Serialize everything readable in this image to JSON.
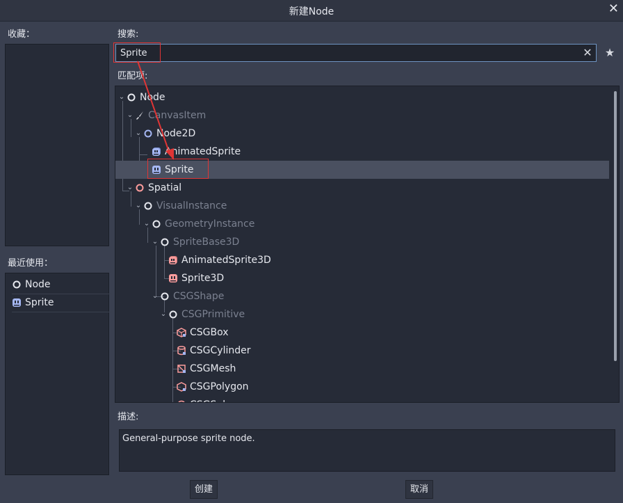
{
  "dialog": {
    "title": "新建Node"
  },
  "favorites": {
    "label": "收藏："
  },
  "recent": {
    "label": "最近使用：",
    "items": [
      {
        "label": "Node",
        "icon": "node-icon"
      },
      {
        "label": "Sprite",
        "icon": "sprite-icon"
      }
    ]
  },
  "search": {
    "label": "搜索:",
    "value": "Sprite"
  },
  "matches": {
    "label": "匹配项:",
    "items": [
      {
        "label": "Node",
        "icon": "node-icon",
        "dim": false
      },
      {
        "label": "CanvasItem",
        "icon": "brush-icon",
        "dim": true
      },
      {
        "label": "Node2D",
        "icon": "node2d-icon",
        "dim": false
      },
      {
        "label": "AnimatedSprite",
        "icon": "animated-sprite-icon",
        "dim": false
      },
      {
        "label": "Sprite",
        "icon": "sprite-icon",
        "dim": false,
        "selected": true
      },
      {
        "label": "Spatial",
        "icon": "spatial-icon",
        "dim": false
      },
      {
        "label": "VisualInstance",
        "icon": "spatial-icon",
        "dim": true
      },
      {
        "label": "GeometryInstance",
        "icon": "spatial-icon",
        "dim": true
      },
      {
        "label": "SpriteBase3D",
        "icon": "spatial-icon",
        "dim": true
      },
      {
        "label": "AnimatedSprite3D",
        "icon": "animated-sprite3d-icon",
        "dim": false
      },
      {
        "label": "Sprite3D",
        "icon": "sprite3d-icon",
        "dim": false
      },
      {
        "label": "CSGShape",
        "icon": "spatial-icon",
        "dim": true
      },
      {
        "label": "CSGPrimitive",
        "icon": "spatial-icon",
        "dim": true
      },
      {
        "label": "CSGBox",
        "icon": "csg-box-icon",
        "dim": false
      },
      {
        "label": "CSGCylinder",
        "icon": "csg-cylinder-icon",
        "dim": false
      },
      {
        "label": "CSGMesh",
        "icon": "csg-mesh-icon",
        "dim": false
      },
      {
        "label": "CSGPolygon",
        "icon": "csg-polygon-icon",
        "dim": false
      },
      {
        "label": "CSGSphere",
        "icon": "csg-sphere-icon",
        "dim": false
      }
    ]
  },
  "description": {
    "label": "描述:",
    "text": "General-purpose sprite node."
  },
  "buttons": {
    "create": "创建",
    "cancel": "取消"
  },
  "colors": {
    "accent": "#6f95c4",
    "annotation": "#e03535",
    "node2d": "#a5b7f3",
    "spatial": "#fc9c9c"
  }
}
